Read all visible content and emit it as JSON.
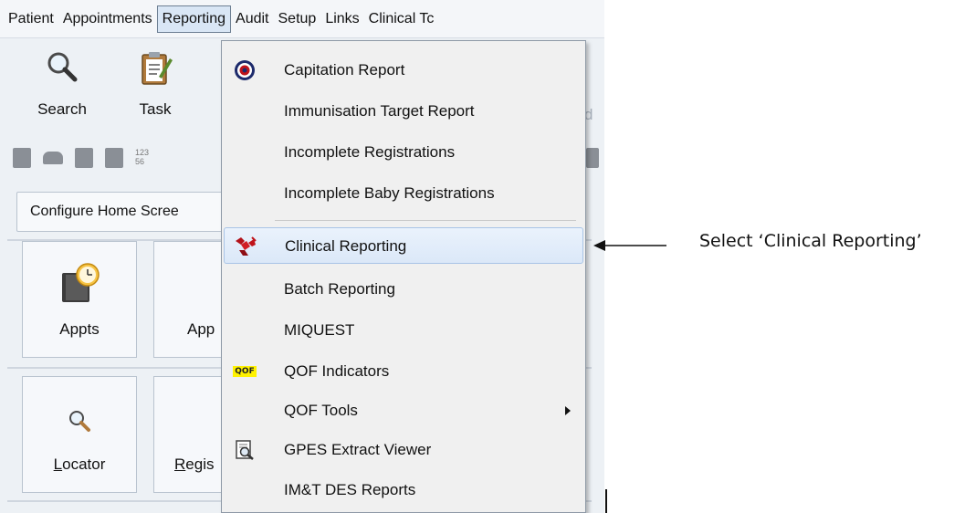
{
  "menubar": {
    "items": [
      {
        "label": "Patient"
      },
      {
        "label": "Appointments"
      },
      {
        "label": "Reporting",
        "active": true
      },
      {
        "label": "Audit"
      },
      {
        "label": "Setup"
      },
      {
        "label": "Links"
      },
      {
        "label": "Clinical Tc"
      }
    ]
  },
  "toolbar": {
    "search_label": "Search",
    "task_label": "Task",
    "faint_label": "d"
  },
  "small_icons": {
    "number_text": "123 56"
  },
  "home": {
    "configure_label": "Configure Home Scree",
    "tiles": [
      {
        "label": "Appts"
      },
      {
        "label": "App"
      },
      {
        "label_prefix": "",
        "label_underline": "L",
        "label_rest": "ocator"
      },
      {
        "label_prefix": "",
        "label_underline": "R",
        "label_rest": "egis"
      }
    ]
  },
  "reporting_menu": {
    "items": [
      {
        "label": "Capitation Report",
        "icon": "target-icon"
      },
      {
        "label": "Immunisation Target Report",
        "icon": ""
      },
      {
        "label": "Incomplete Registrations",
        "icon": ""
      },
      {
        "label": "Incomplete Baby Registrations",
        "icon": ""
      },
      {
        "label": "Clinical Reporting",
        "icon": "clinical-reporting-icon",
        "highlighted": true
      },
      {
        "label": "Batch Reporting",
        "icon": ""
      },
      {
        "label": "MIQUEST",
        "icon": ""
      },
      {
        "label": "QOF Indicators",
        "icon": "qof-icon",
        "badge": "QOF"
      },
      {
        "label": "QOF Tools",
        "icon": "",
        "submenu": true
      },
      {
        "label": "GPES Extract Viewer",
        "icon": "document-search-icon"
      },
      {
        "label": "IM&T DES Reports",
        "icon": ""
      }
    ]
  },
  "annotation": {
    "text": "Select ‘Clinical Reporting’"
  },
  "colors": {
    "window_bg": "#edf1f5",
    "menu_bg": "#f0f0f0",
    "highlight_border": "#a9c4e6",
    "target_red": "#c0131a",
    "target_navy": "#1d2a6b",
    "qof_yellow": "#fff200"
  }
}
